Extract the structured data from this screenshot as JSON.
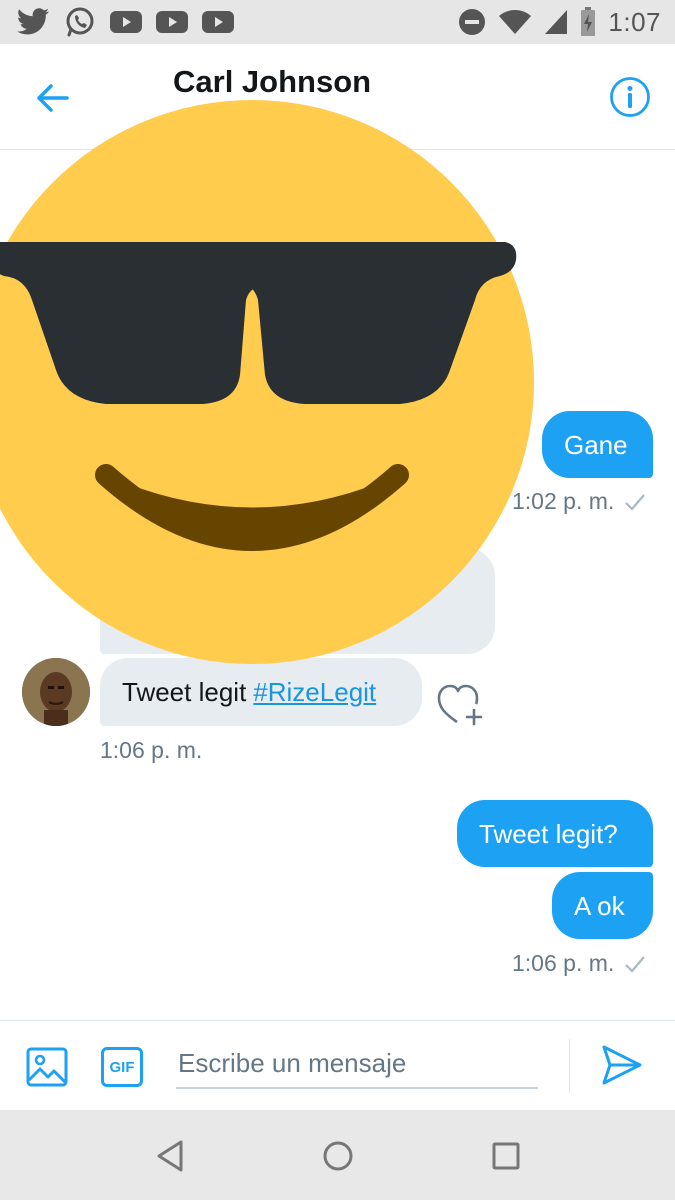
{
  "status_bar": {
    "time": "1:07",
    "left_icons": [
      "twitter-icon",
      "whatsapp-icon",
      "youtube-icon",
      "youtube-icon",
      "youtube-icon"
    ],
    "right_icons": [
      "do-not-disturb-icon",
      "wifi-icon",
      "signal-icon",
      "battery-charging-icon"
    ]
  },
  "header": {
    "title": "Carl Johnson",
    "back_icon": "arrow-left-icon",
    "info_icon": "info-icon"
  },
  "messages": {
    "out_1": {
      "text": "Gane",
      "time": "1:02 p. m."
    },
    "in_1": {
      "text": "Tweet legit",
      "hashtag": "#RizeLegit",
      "time": "1:06 p. m."
    },
    "out_2": {
      "text": "Tweet legit?"
    },
    "out_3": {
      "text": "A ok",
      "time": "1:06 p. m."
    }
  },
  "overlay": {
    "emoji": "sunglasses-emoji"
  },
  "composer": {
    "placeholder": "Escribe un mensaje",
    "gif_label": "GIF"
  },
  "colors": {
    "accent": "#1da1f2",
    "outgoing_bubble": "#1da1f2",
    "incoming_bubble": "#e6ecf0",
    "timestamp": "#657786",
    "emoji_face": "#ffcc4d",
    "emoji_glasses": "#292f33",
    "emoji_mouth": "#664500"
  }
}
